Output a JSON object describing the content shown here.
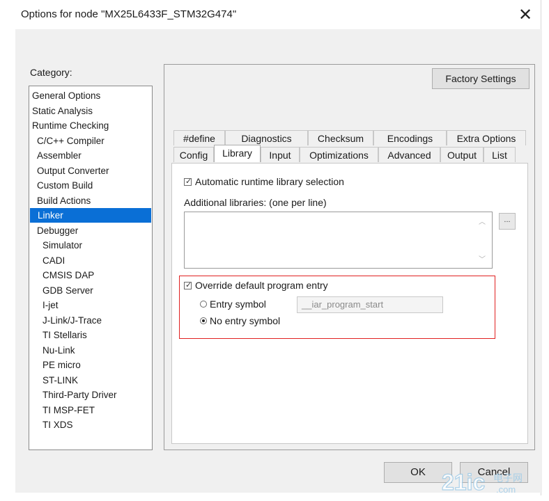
{
  "window": {
    "title": "Options for node \"MX25L6433F_STM32G474\"",
    "close_glyph": "✕"
  },
  "category": {
    "label": "Category:",
    "items": [
      {
        "label": "General Options",
        "indent": 0
      },
      {
        "label": "Static Analysis",
        "indent": 0
      },
      {
        "label": "Runtime Checking",
        "indent": 0
      },
      {
        "label": "C/C++ Compiler",
        "indent": 1
      },
      {
        "label": "Assembler",
        "indent": 1
      },
      {
        "label": "Output Converter",
        "indent": 1
      },
      {
        "label": "Custom Build",
        "indent": 1
      },
      {
        "label": "Build Actions",
        "indent": 1
      },
      {
        "label": "Linker",
        "indent": 1,
        "selected": true
      },
      {
        "label": "Debugger",
        "indent": 1
      },
      {
        "label": "Simulator",
        "indent": 2
      },
      {
        "label": "CADI",
        "indent": 2
      },
      {
        "label": "CMSIS DAP",
        "indent": 2
      },
      {
        "label": "GDB Server",
        "indent": 2
      },
      {
        "label": "I-jet",
        "indent": 2
      },
      {
        "label": "J-Link/J-Trace",
        "indent": 2
      },
      {
        "label": "TI Stellaris",
        "indent": 2
      },
      {
        "label": "Nu-Link",
        "indent": 2
      },
      {
        "label": "PE micro",
        "indent": 2
      },
      {
        "label": "ST-LINK",
        "indent": 2
      },
      {
        "label": "Third-Party Driver",
        "indent": 2
      },
      {
        "label": "TI MSP-FET",
        "indent": 2
      },
      {
        "label": "TI XDS",
        "indent": 2
      }
    ]
  },
  "factory_settings": "Factory Settings",
  "tabs_row1": [
    "#define",
    "Diagnostics",
    "Checksum",
    "Encodings",
    "Extra Options"
  ],
  "tabs_row2": [
    "Config",
    "Library",
    "Input",
    "Optimizations",
    "Advanced",
    "Output",
    "List"
  ],
  "active_tab": "Library",
  "library": {
    "auto_runtime_label": "Automatic runtime library selection",
    "auto_runtime_checked": true,
    "additional_libraries_label": "Additional libraries: (one per line)",
    "additional_libraries_value": "",
    "browse_label": "...",
    "override_entry_label": "Override default program entry",
    "override_entry_checked": true,
    "entry_symbol_label": "Entry symbol",
    "entry_symbol_value": "__iar_program_start",
    "no_entry_symbol_label": "No entry symbol",
    "selected_option": "No entry symbol"
  },
  "buttons": {
    "ok": "OK",
    "cancel": "Cancel"
  },
  "watermark": {
    "text_main": "21ic",
    "text_cn": "电子网",
    "text_sub": ".com"
  },
  "colors": {
    "selection": "#0a6fd6",
    "highlight_box": "#e02020"
  }
}
